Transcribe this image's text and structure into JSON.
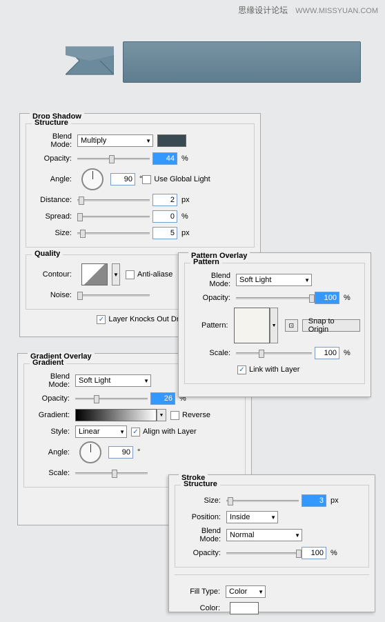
{
  "watermark": {
    "cn": "思缘设计论坛",
    "url": "WWW.MISSYUAN.COM"
  },
  "panels": {
    "dropShadow": {
      "title": "Drop Shadow",
      "structure": "Structure",
      "quality": "Quality",
      "blendModeLabel": "Blend Mode:",
      "blendMode": "Multiply",
      "opacityLabel": "Opacity:",
      "opacity": "44",
      "angleLabel": "Angle:",
      "angle": "90",
      "degree": "°",
      "useGlobalLight": "Use Global Light",
      "distanceLabel": "Distance:",
      "distance": "2",
      "spreadLabel": "Spread:",
      "spread": "0",
      "sizeLabel": "Size:",
      "size": "5",
      "contourLabel": "Contour:",
      "antiAliase": "Anti-aliase",
      "noiseLabel": "Noise:",
      "knockOut": "Layer Knocks Out Dro",
      "px": "px",
      "pct": "%"
    },
    "gradientOverlay": {
      "title": "Gradient Overlay",
      "gradient": "Gradient",
      "blendModeLabel": "Blend Mode:",
      "blendMode": "Soft Light",
      "opacityLabel": "Opacity:",
      "opacity": "26",
      "gradientLabel": "Gradient:",
      "reverse": "Reverse",
      "styleLabel": "Style:",
      "style": "Linear",
      "alignWithLayer": "Align with Layer",
      "angleLabel": "Angle:",
      "angle": "90",
      "degree": "°",
      "scaleLabel": "Scale:",
      "pct": "%"
    },
    "patternOverlay": {
      "title": "Pattern Overlay",
      "pattern": "Pattern",
      "blendModeLabel": "Blend Mode:",
      "blendMode": "Soft Light",
      "opacityLabel": "Opacity:",
      "opacity": "100",
      "patternLabel": "Pattern:",
      "snapToOrigin": "Snap to Origin",
      "scaleLabel": "Scale:",
      "scale": "100",
      "linkWithLayer": "Link with Layer",
      "pct": "%"
    },
    "stroke": {
      "title": "Stroke",
      "structure": "Structure",
      "sizeLabel": "Size:",
      "size": "3",
      "positionLabel": "Position:",
      "position": "Inside",
      "blendModeLabel": "Blend Mode:",
      "blendMode": "Normal",
      "opacityLabel": "Opacity:",
      "opacity": "100",
      "fillTypeLabel": "Fill Type:",
      "fillType": "Color",
      "colorLabel": "Color:",
      "px": "px",
      "pct": "%"
    }
  }
}
